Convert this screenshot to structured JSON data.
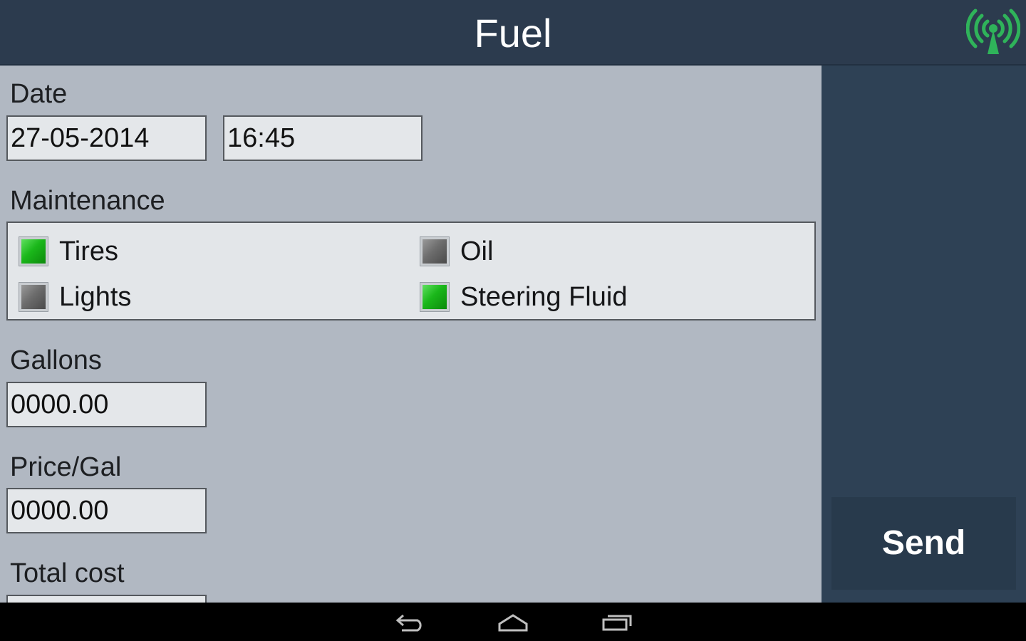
{
  "header": {
    "title": "Fuel",
    "signal_icon": "wireless-signal-icon",
    "signal_color": "#2fb35a"
  },
  "form": {
    "date_label": "Date",
    "date_value": "27-05-2014",
    "time_value": "16:45",
    "maintenance_label": "Maintenance",
    "maintenance_items": [
      {
        "label": "Tires",
        "checked": true
      },
      {
        "label": "Oil",
        "checked": false
      },
      {
        "label": "Lights",
        "checked": false
      },
      {
        "label": "Steering Fluid",
        "checked": true
      }
    ],
    "gallons_label": "Gallons",
    "gallons_value": "0000.00",
    "price_label": "Price/Gal",
    "price_value": "0000.00",
    "total_label": "Total cost"
  },
  "actions": {
    "send_label": "Send"
  },
  "navbar": {
    "icons": [
      "back-icon",
      "home-icon",
      "recent-apps-icon"
    ]
  },
  "colors": {
    "checked": "#1ab71a",
    "unchecked": "#6d6d6d",
    "form_bg": "#b1b8c2",
    "header_bg": "#2c3b4e"
  }
}
